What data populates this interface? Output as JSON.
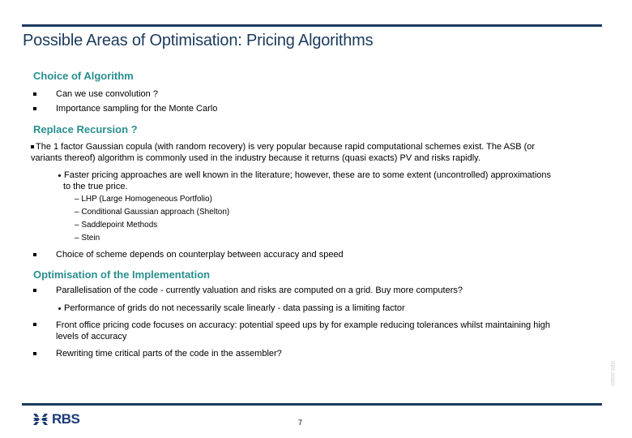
{
  "slide": {
    "title": "Possible Areas of Optimisation: Pricing Algorithms",
    "colors": {
      "title": "#1b3a5c",
      "heading": "#2a8f8f",
      "rule": "#1b3a5c"
    }
  },
  "sections": {
    "choice": {
      "heading": "Choice of Algorithm",
      "bullets": [
        "Can we use convolution ?",
        "Importance sampling for the Monte Carlo"
      ]
    },
    "recursion": {
      "heading": "Replace Recursion ?",
      "para_line1": "The 1 factor Gaussian copula (with random recovery) is very popular because rapid computational schemes exist. The ASB (or",
      "para_line2": "variants thereof) algorithm is commonly used in the industry because it returns (quasi exacts) PV and risks rapidly.",
      "sub_line1": "Faster pricing approaches are well known in the literature; however, these are to some extent (uncontrolled) approximations",
      "sub_line2": "to the true price.",
      "dash_items": [
        "LHP (Large Homogeneous Portfolio)",
        "Conditional Gaussian approach (Shelton)",
        "Saddlepoint Methods",
        "Stein"
      ],
      "bullet_after": "Choice of scheme depends on counterplay between accuracy and speed"
    },
    "implementation": {
      "heading": "Optimisation of the Implementation",
      "bullet1": "Parallelisation of the code - currently valuation and risks are computed on a grid. Buy more computers?",
      "sub1": "Performance of grids do not necessarily scale linearly - data passing is a limiting factor",
      "bullet2_line1": "Front office pricing code focuses on accuracy: potential speed ups by for example reducing tolerances whilst maintaining high",
      "bullet2_line2": "levels of accuracy",
      "bullet3": "Rewriting time critical parts of the code in the assembler?"
    }
  },
  "footer": {
    "logo_text": "RBS",
    "logo_icon": "rbs-daisy-wheel-icon",
    "page_number": "7",
    "side_code": "RBS 00000"
  }
}
